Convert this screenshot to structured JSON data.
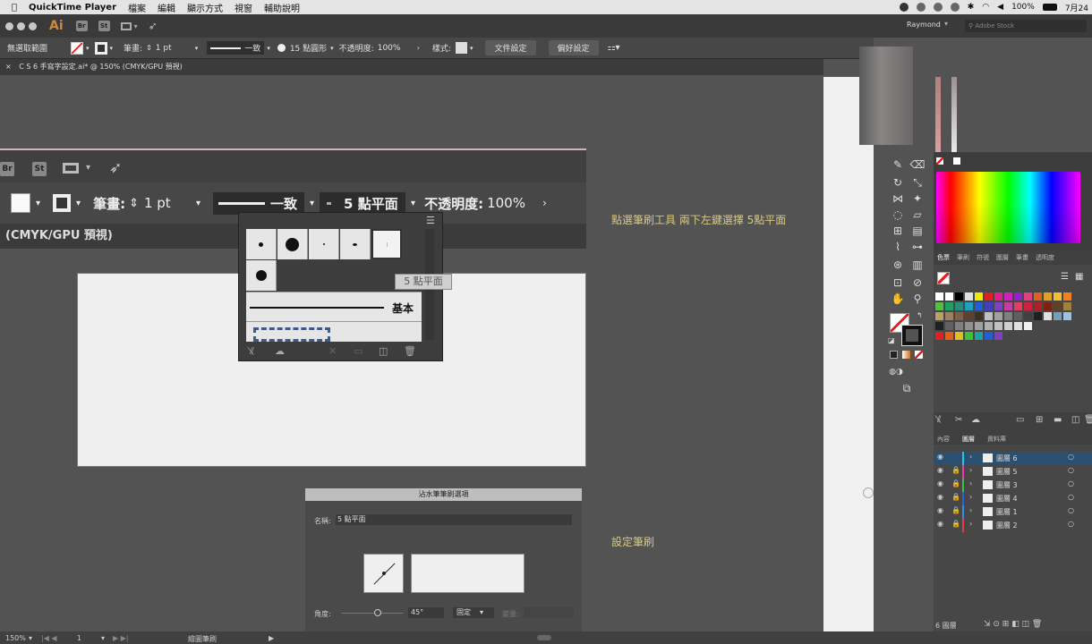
{
  "menubar": {
    "app_name": "QuickTime Player",
    "menus": [
      "檔案",
      "編輯",
      "顯示方式",
      "視窗",
      "輔助說明"
    ],
    "battery": "100%",
    "time": "7月24"
  },
  "titlebar": {
    "logo": "Ai",
    "br": "Br",
    "st": "St",
    "user": "Raymond",
    "search_placeholder": "Adobe Stock"
  },
  "control_bar": {
    "selection": "無選取範圍",
    "stroke_label": "筆畫:",
    "stroke_value": "1 pt",
    "profile": "一致",
    "brush": "15 點圓形",
    "opacity_label": "不透明度:",
    "opacity_value": "100%",
    "style_label": "樣式:",
    "doc_setup": "文件設定",
    "prefs": "偏好設定"
  },
  "doc_tab": {
    "close": "×",
    "title": "C S 6 手寫字設定.ai* @ 150% (CMYK/GPU 預視)"
  },
  "zoomed": {
    "br": "Br",
    "st": "St",
    "stroke_label": "筆畫:",
    "stroke_value": "1 pt",
    "profile": "一致",
    "brush": "5 點平面",
    "opacity_label": "不透明度:",
    "opacity_value": "100%",
    "tab": "(CMYK/GPU 預視)"
  },
  "brush_popup": {
    "tooltip": "5 點平面",
    "basic_label": "基本"
  },
  "captions": {
    "line1": "點選筆刷工具 兩下左鍵選擇 5點平面",
    "line2": "設定筆刷"
  },
  "dialog": {
    "title": "沾水筆筆刷選項",
    "name_label": "名稱:",
    "name_value": "5 點平面",
    "angle_label": "角度:",
    "angle_value": "45°",
    "mode": "固定",
    "variation_label": "變量:"
  },
  "status": {
    "zoom": "150%",
    "page": "1",
    "tool": "繪圖筆刷"
  },
  "panels": {
    "color_tabs": [
      "色票",
      "筆刷",
      "符號",
      "圖層",
      "筆畫",
      "透明度"
    ],
    "layers_tabs": [
      "內容",
      "圖層",
      "資料庫"
    ],
    "layers": [
      {
        "name": "圖層 6",
        "color": "#1ec8e0"
      },
      {
        "name": "圖層 5",
        "color": "#e040b0"
      },
      {
        "name": "圖層 3",
        "color": "#40c040"
      },
      {
        "name": "圖層 4",
        "color": "#3060e0"
      },
      {
        "name": "圖層 1",
        "color": "#3090e0"
      },
      {
        "name": "圖層 2",
        "color": "#e04040"
      }
    ],
    "layers_count": "6 圖層"
  }
}
